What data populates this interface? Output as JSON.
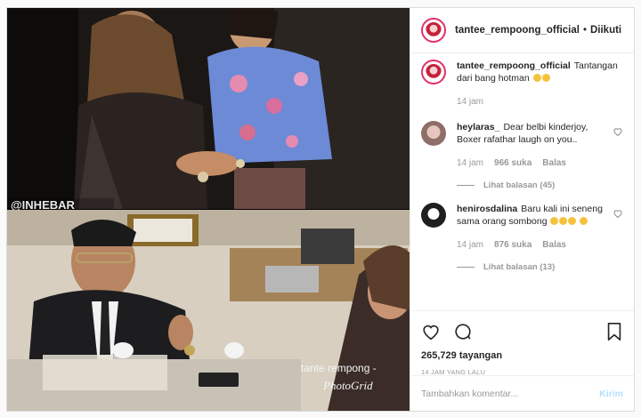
{
  "post": {
    "author": "tantee_rempoong_official",
    "separator": "•",
    "follow_status": "Diikuti",
    "caption_user": "tantee_rempoong_official",
    "caption_text": "Tantangan dari bang hotman",
    "caption_time": "14 jam",
    "views": "265,729 tayangan",
    "posted_ago": "14 JAM YANG LALU"
  },
  "media": {
    "watermark_top": "@INHEBAR",
    "watermark_bottom_1": "tante rempong -",
    "watermark_bottom_2": "PhotoGrid"
  },
  "comments": [
    {
      "user": "heylaras_",
      "text": "Dear belbi kinderjoy, Boxer rafathar laugh on you..",
      "time": "14 jam",
      "likes": "966 suka",
      "reply": "Balas",
      "replies_label": "Lihat balasan (45)"
    },
    {
      "user": "henirosdalina",
      "text": "Baru kali ini seneng sama orang sombong",
      "time": "14 jam",
      "likes": "876 suka",
      "reply": "Balas",
      "replies_label": "Lihat balasan (13)"
    }
  ],
  "add_comment": {
    "placeholder": "Tambahkan komentar...",
    "submit_label": "Kirim"
  },
  "icons": [
    "heart-icon",
    "comment-icon",
    "bookmark-icon",
    "small-heart-icon",
    "emoji-icon"
  ],
  "colors": {
    "link_disabled": "#b2dffc",
    "muted": "#999999",
    "story_ring": "#e1306c"
  }
}
